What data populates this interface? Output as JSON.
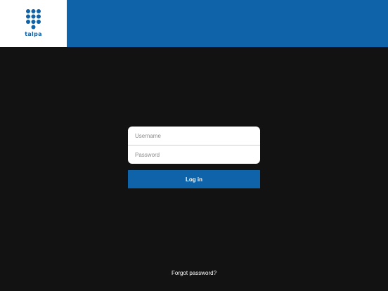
{
  "brand": {
    "logo_text": "talpa",
    "header_color": "#0f63a8",
    "logo_bg": "#ffffff"
  },
  "login": {
    "username_placeholder": "Username",
    "username_value": "",
    "password_placeholder": "Password",
    "password_value": "",
    "submit_label": "Log in"
  },
  "footer": {
    "forgot_password_label": "Forgot password?"
  },
  "colors": {
    "background": "#121212",
    "accent": "#0f63a8",
    "card": "#ffffff"
  }
}
